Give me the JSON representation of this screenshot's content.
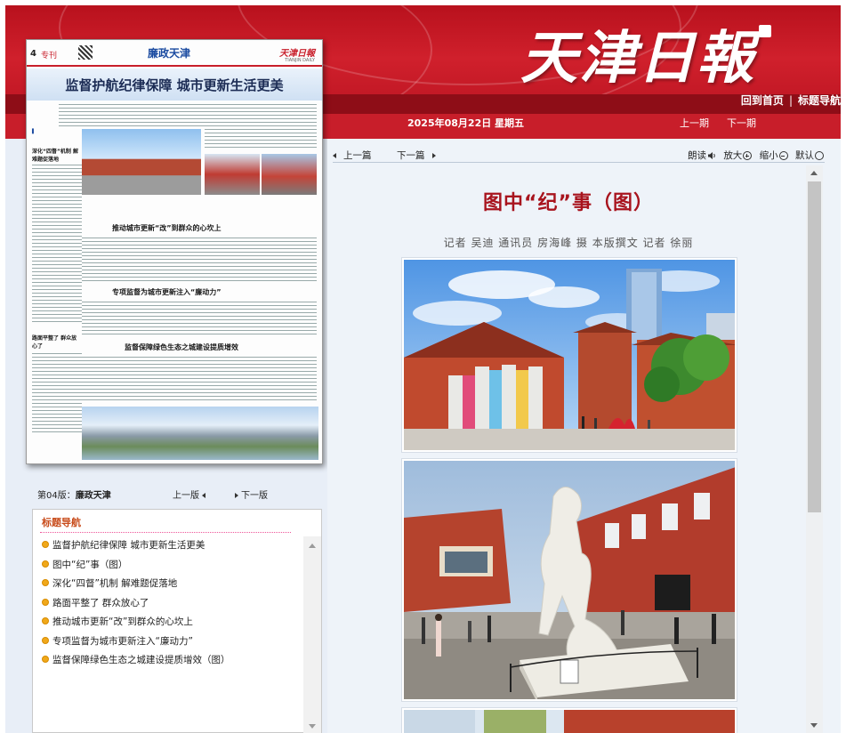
{
  "header": {
    "masthead": "天津日報",
    "nav": {
      "home": "回到首页",
      "separator": "|",
      "title_nav": "标题导航"
    },
    "date": "2025年08月22日 星期五",
    "date_nav": {
      "prev": "上一期",
      "next": "下一期"
    }
  },
  "thumbnail": {
    "page_no": "4",
    "tag": "专刊",
    "column": "廉政天津",
    "logo": "天津日報",
    "sub": "TIANJIN DAILY",
    "headline": "监督护航纪律保障 城市更新生活更美",
    "sections": [
      "推动城市更新“改”到群众的心坎上",
      "专项监督为城市更新注入“廉动力”",
      "监督保障绿色生态之城建设提质增效"
    ],
    "side_heads": [
      "深化“四督”机制 解难题促落地",
      "路面平整了 群众放心了"
    ]
  },
  "page_nav": {
    "label_prefix": "第04版：",
    "label_name": "廉政天津",
    "prev": "上一版",
    "next": "下一版"
  },
  "title_nav": {
    "heading": "标题导航",
    "items": [
      "监督护航纪律保障 城市更新生活更美",
      "图中“纪”事（图）",
      "深化“四督”机制 解难题促落地",
      "路面平整了 群众放心了",
      "推动城市更新“改”到群众的心坎上",
      "专项监督为城市更新注入“廉动力”",
      "监督保障绿色生态之城建设提质增效（图）"
    ]
  },
  "article_toolbar": {
    "prev": "上一篇",
    "next": "下一篇",
    "read_aloud": "朗读",
    "zoom_in": "放大",
    "zoom_out": "缩小",
    "default": "默认"
  },
  "article": {
    "title": "图中“纪”事（图）",
    "byline": "记者 吴迪 通讯员 房海峰 摄 本版撰文 记者 徐丽"
  },
  "colors": {
    "brand_red": "#c81e2a",
    "dark_red": "#8e0d17",
    "title_red": "#a8141e",
    "nav_orange": "#c84b1a"
  }
}
